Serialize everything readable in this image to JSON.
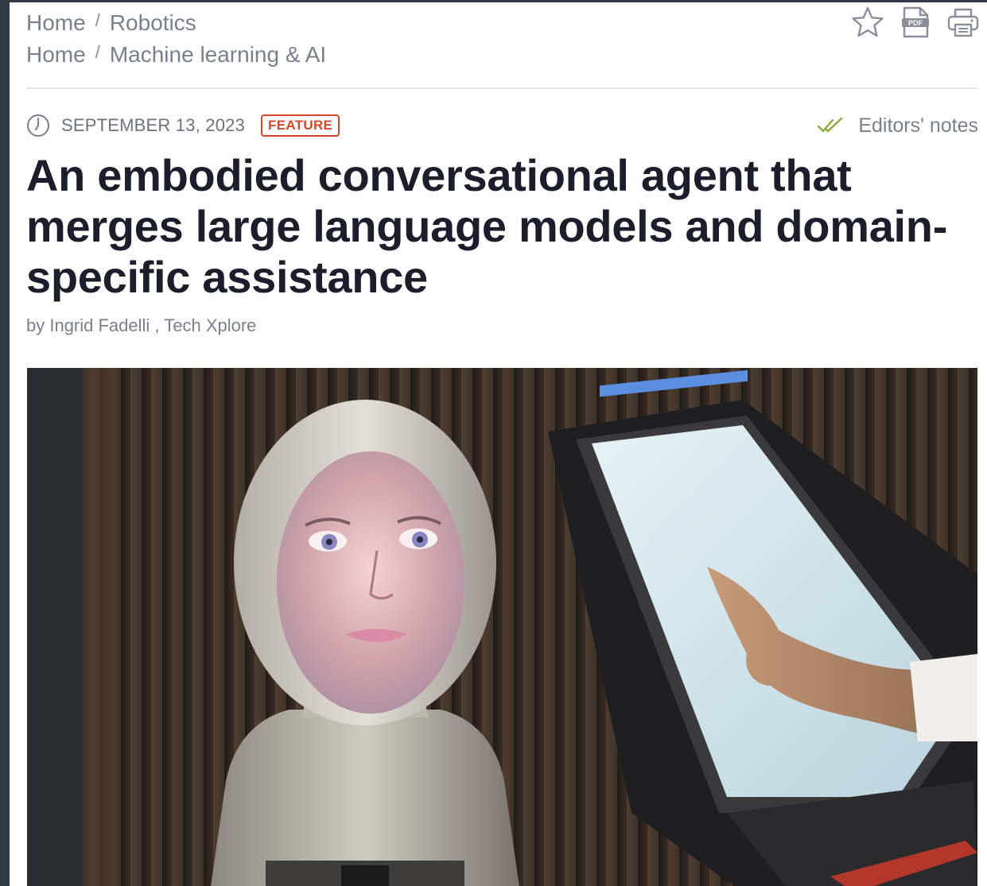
{
  "breadcrumbs": [
    {
      "home": "Home",
      "separator": "/",
      "section": "Robotics"
    },
    {
      "home": "Home",
      "separator": "/",
      "section": "Machine learning & AI"
    }
  ],
  "toolbar": {
    "bookmark_icon": "star-icon",
    "pdf_icon": "pdf-icon",
    "pdf_label": "PDF",
    "print_icon": "printer-icon"
  },
  "meta": {
    "date": "SEPTEMBER 13, 2023",
    "badge": "FEATURE",
    "editors_notes": "Editors' notes"
  },
  "article": {
    "title": "An embodied conversational agent that merges large language models and domain-specific assistance",
    "byline": "by Ingrid Fadelli , Tech Xplore"
  },
  "colors": {
    "badge": "#d2482a",
    "check": "#8aa93a",
    "title": "#1d1e2b",
    "muted": "#7b7f8c"
  }
}
